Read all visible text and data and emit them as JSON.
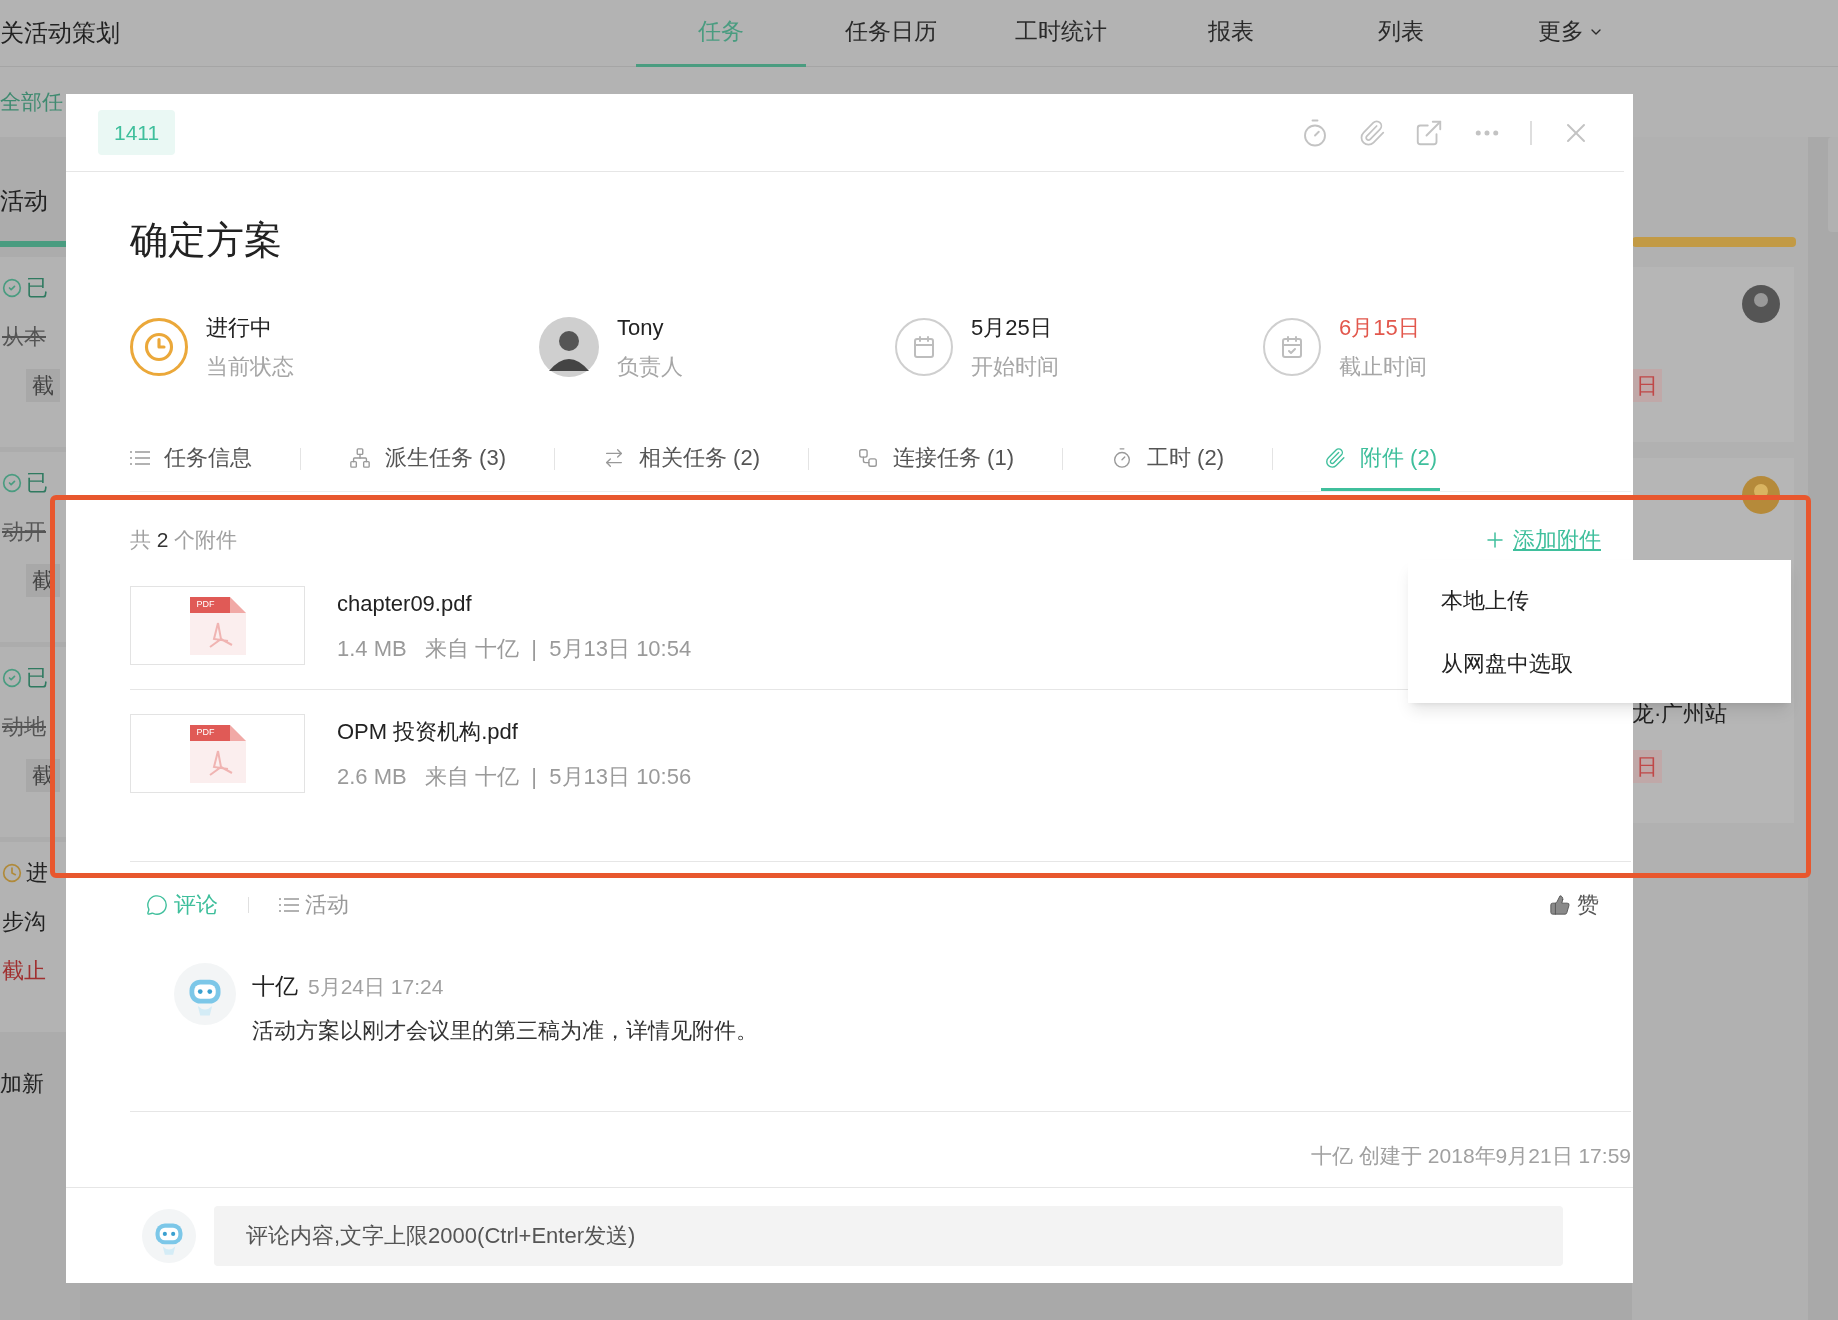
{
  "background": {
    "project_title": "关活动策划",
    "nav": [
      {
        "label": "任务",
        "selected": true
      },
      {
        "label": "任务日历",
        "selected": false
      },
      {
        "label": "工时统计",
        "selected": false
      },
      {
        "label": "报表",
        "selected": false
      },
      {
        "label": "列表",
        "selected": false
      },
      {
        "label": "更多",
        "selected": false
      }
    ],
    "filter": "全部任",
    "left_column": {
      "title": "活动",
      "cards": [
        {
          "kind": "done",
          "status": "已",
          "text": "从本",
          "due": "截"
        },
        {
          "kind": "done",
          "status": "已",
          "text": "动开",
          "due": "截"
        },
        {
          "kind": "done",
          "status": "已",
          "text": "动地",
          "due": "截"
        },
        {
          "kind": "doing",
          "status": "进",
          "text": "步沟",
          "due": "截止"
        }
      ],
      "add": "加新"
    },
    "right_column": {
      "cards": [
        {
          "due": "日"
        },
        {
          "text": "龙·广州站",
          "due": "日"
        }
      ]
    }
  },
  "task": {
    "id": "1411",
    "title": "确定方案",
    "info": [
      {
        "kind": "status",
        "value": "进行中",
        "label": "当前状态",
        "overdue": false
      },
      {
        "kind": "assignee",
        "value": "Tony",
        "label": "负责人",
        "overdue": false
      },
      {
        "kind": "start",
        "value": "5月25日",
        "label": "开始时间",
        "overdue": false
      },
      {
        "kind": "due",
        "value": "6月15日",
        "label": "截止时间",
        "overdue": true
      }
    ],
    "tabs": [
      {
        "label": "任务信息",
        "selected": false
      },
      {
        "label": "派生任务 (3)",
        "selected": false
      },
      {
        "label": "相关任务 (2)",
        "selected": false
      },
      {
        "label": "连接任务 (1)",
        "selected": false
      },
      {
        "label": "工时 (2)",
        "selected": false
      },
      {
        "label": "附件 (2)",
        "selected": true
      }
    ],
    "attachments": {
      "separator": "|",
      "prefix": "共",
      "count": "2",
      "suffix": "个附件",
      "add": "添加附件",
      "add_menu": [
        "本地上传",
        "从网盘中选取"
      ],
      "files": [
        {
          "type": "PDF",
          "name": "chapter09.pdf",
          "size": "1.4 MB",
          "source": "来自 十亿",
          "date": "5月13日 10:54"
        },
        {
          "type": "PDF",
          "name": "OPM 投资机构.pdf",
          "size": "2.6 MB",
          "source": "来自 十亿",
          "date": "5月13日 10:56"
        }
      ]
    },
    "feed_tabs": [
      {
        "label": "评论",
        "selected": true
      },
      {
        "label": "活动",
        "selected": false
      }
    ],
    "like": "赞",
    "comments": [
      {
        "author": "十亿",
        "time": "5月24日 17:24",
        "text": "活动方案以刚才会议里的第三稿为准，详情见附件。"
      }
    ],
    "created": "十亿 创建于 2018年9月21日 17:59",
    "comment_placeholder": "评论内容,文字上限2000(Ctrl+Enter发送)"
  }
}
